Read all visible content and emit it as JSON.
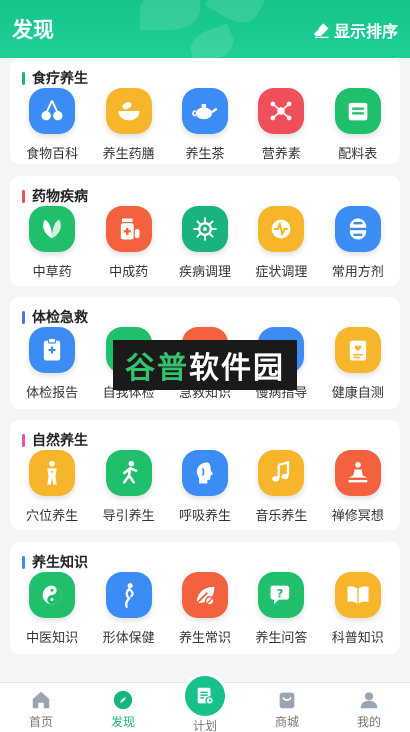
{
  "header": {
    "title": "发现",
    "sort_label": "显示排序"
  },
  "watermark": {
    "text_a": "谷普",
    "text_b": "软件园"
  },
  "sections": [
    {
      "title": "食疗养生",
      "bar_color": "#19b37e",
      "items": [
        {
          "label": "食物百科",
          "icon": "cherry-icon",
          "color": "#3b8df5"
        },
        {
          "label": "养生药膳",
          "icon": "medicine-bowl-icon",
          "color": "#f7b52b"
        },
        {
          "label": "养生茶",
          "icon": "teapot-icon",
          "color": "#3b8df5"
        },
        {
          "label": "营养素",
          "icon": "molecule-icon",
          "color": "#ef4f5a"
        },
        {
          "label": "配料表",
          "icon": "ingredient-box-icon",
          "color": "#1fbf6c"
        }
      ]
    },
    {
      "title": "药物疾病",
      "bar_color": "#ef4f5a",
      "items": [
        {
          "label": "中草药",
          "icon": "herb-leaf-icon",
          "color": "#1fbf6c"
        },
        {
          "label": "中成药",
          "icon": "pill-bottle-icon",
          "color": "#f4613e"
        },
        {
          "label": "疾病调理",
          "icon": "virus-icon",
          "color": "#19b37e"
        },
        {
          "label": "症状调理",
          "icon": "pulse-icon",
          "color": "#f7b52b"
        },
        {
          "label": "常用方剂",
          "icon": "capsule-icon",
          "color": "#3b8df5"
        }
      ]
    },
    {
      "title": "体检急救",
      "bar_color": "#5b6ff0",
      "items": [
        {
          "label": "体检报告",
          "icon": "clipboard-icon",
          "color": "#3b8df5"
        },
        {
          "label": "自我体检",
          "icon": "self-check-icon",
          "color": "#1fbf6c"
        },
        {
          "label": "急救知识",
          "icon": "first-aid-icon",
          "color": "#f4613e"
        },
        {
          "label": "慢病指导",
          "icon": "chronic-guide-icon",
          "color": "#3b8df5"
        },
        {
          "label": "健康自测",
          "icon": "health-test-icon",
          "color": "#f7b52b"
        }
      ]
    },
    {
      "title": "自然养生",
      "bar_color": "#e8559a",
      "items": [
        {
          "label": "穴位养生",
          "icon": "acupoint-body-icon",
          "color": "#f7b52b"
        },
        {
          "label": "导引养生",
          "icon": "exercise-icon",
          "color": "#1fbf6c"
        },
        {
          "label": "呼吸养生",
          "icon": "breathing-head-icon",
          "color": "#3b8df5"
        },
        {
          "label": "音乐养生",
          "icon": "music-note-icon",
          "color": "#f7b52b"
        },
        {
          "label": "禅修冥想",
          "icon": "meditation-icon",
          "color": "#f4613e"
        }
      ]
    },
    {
      "title": "养生知识",
      "bar_color": "#3b8df5",
      "items": [
        {
          "label": "中医知识",
          "icon": "yin-yang-icon",
          "color": "#1fbf6c"
        },
        {
          "label": "形体保健",
          "icon": "body-figure-icon",
          "color": "#3b8df5"
        },
        {
          "label": "养生常识",
          "icon": "leaf-no-icon",
          "color": "#f4613e"
        },
        {
          "label": "养生问答",
          "icon": "qa-bubble-icon",
          "color": "#1fbf6c"
        },
        {
          "label": "科普知识",
          "icon": "open-book-icon",
          "color": "#f7b52b"
        }
      ]
    }
  ],
  "tabbar": {
    "tabs": [
      {
        "label": "首页",
        "icon": "home-icon"
      },
      {
        "label": "发现",
        "icon": "compass-icon"
      },
      {
        "label": "计划",
        "icon": "plan-icon"
      },
      {
        "label": "商城",
        "icon": "shop-bag-icon"
      },
      {
        "label": "我的",
        "icon": "user-icon"
      }
    ],
    "active_color": "#16b57e",
    "inactive_color": "#9aa4b2"
  }
}
